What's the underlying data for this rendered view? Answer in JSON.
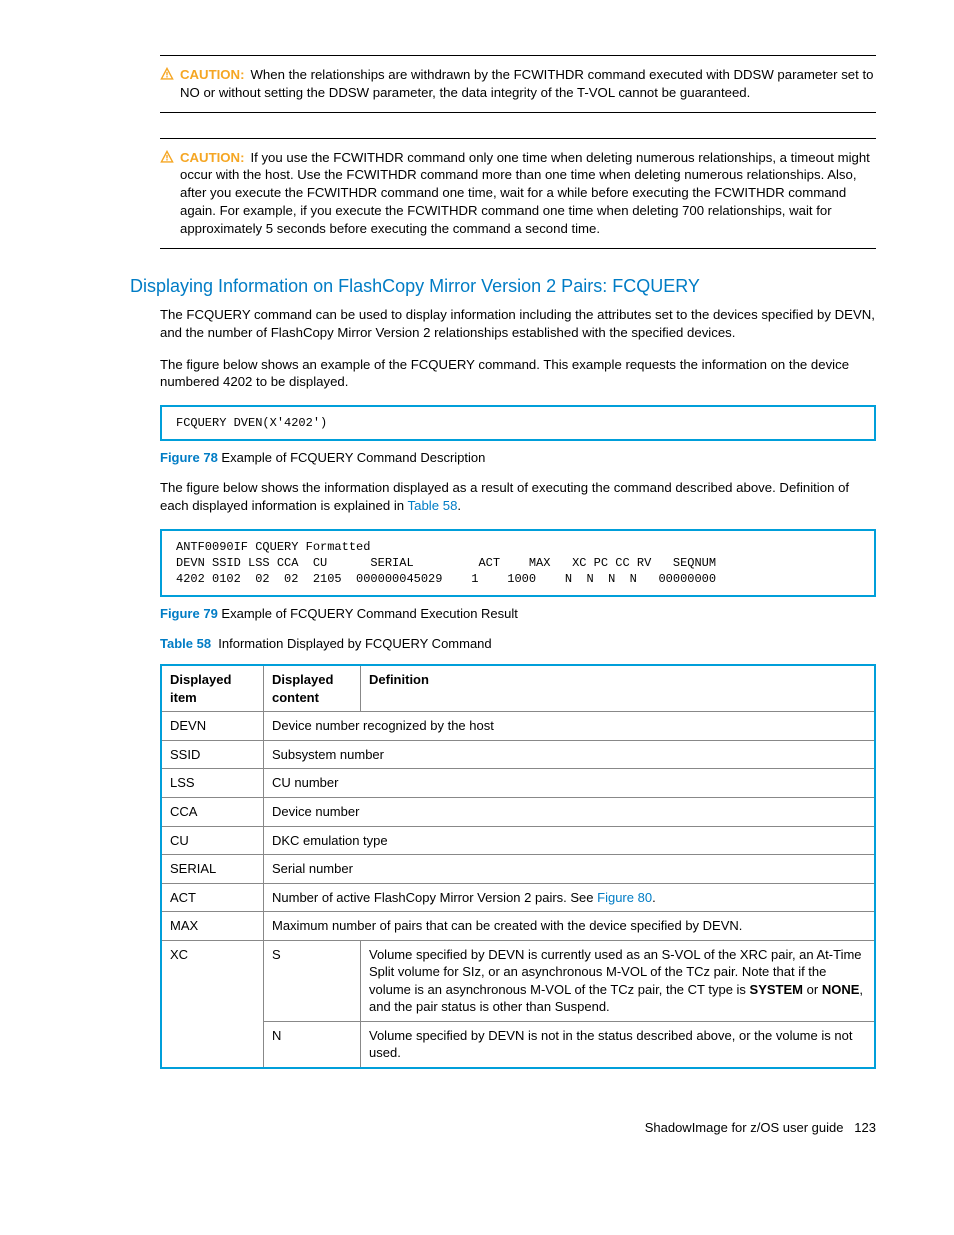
{
  "caution1": {
    "label": "CAUTION:",
    "text": "When the relationships are withdrawn by the FCWITHDR command executed with DDSW parameter set to NO or without setting the DDSW parameter, the data integrity of the T-VOL cannot be guaranteed."
  },
  "caution2": {
    "label": "CAUTION:",
    "text": "If you use the FCWITHDR command only one time when deleting numerous relationships, a timeout might occur with the host. Use the FCWITHDR command more than one time when deleting numerous relationships. Also, after you execute the FCWITHDR command one time, wait for a while before executing the FCWITHDR command again. For example, if you execute the FCWITHDR command one time when deleting 700 relationships, wait for approximately 5 seconds before executing the command a second time."
  },
  "section_title": "Displaying Information on FlashCopy Mirror Version 2 Pairs: FCQUERY",
  "para1": "The FCQUERY command can be used to display information including the attributes set to the devices specified by DEVN, and the number of FlashCopy Mirror Version 2 relationships established with the specified devices.",
  "para2": "The figure below shows an example of the FCQUERY command. This example requests the information on the device numbered 4202 to be displayed.",
  "code1": "FCQUERY DVEN(X'4202')",
  "fig78": {
    "label": "Figure 78",
    "text": "Example of FCQUERY Command Description"
  },
  "para3_a": "The figure below shows the information displayed as a result of executing the command described above. Definition of each displayed information is explained in ",
  "para3_link": "Table 58",
  "para3_b": ".",
  "code2": "ANTF0090IF CQUERY Formatted\nDEVN SSID LSS CCA  CU      SERIAL         ACT    MAX   XC PC CC RV   SEQNUM\n4202 0102  02  02  2105  000000045029    1    1000    N  N  N  N   00000000",
  "fig79": {
    "label": "Figure 79",
    "text": "Example of FCQUERY Command Execution Result"
  },
  "tab58": {
    "label": "Table 58",
    "text": "Information Displayed by FCQUERY Command"
  },
  "table": {
    "headers": {
      "c1": "Displayed item",
      "c2": "Displayed content",
      "c3": "Definition"
    },
    "rows": [
      {
        "item": "DEVN",
        "def": "Device number recognized by the host"
      },
      {
        "item": "SSID",
        "def": "Subsystem number"
      },
      {
        "item": "LSS",
        "def": "CU number"
      },
      {
        "item": "CCA",
        "def": "Device number"
      },
      {
        "item": "CU",
        "def": "DKC emulation type"
      },
      {
        "item": "SERIAL",
        "def": "Serial number"
      },
      {
        "item": "ACT",
        "def_a": "Number of active FlashCopy Mirror Version 2 pairs. See ",
        "def_link": "Figure 80",
        "def_b": "."
      },
      {
        "item": "MAX",
        "def": "Maximum number of pairs that can be created with the device specified by DEVN."
      }
    ],
    "xc": {
      "item": "XC",
      "s_content": "S",
      "s_def_a": "Volume specified by DEVN is currently used as an S-VOL of the XRC pair, an At-Time Split volume for SIz, or an asynchronous M-VOL of the TCz pair. Note that if the volume is an asynchronous M-VOL of the TCz pair, the CT type is ",
      "s_def_bold1": "SYSTEM",
      "s_def_mid": " or ",
      "s_def_bold2": "NONE",
      "s_def_b": ", and the pair status is other than Suspend.",
      "n_content": "N",
      "n_def": "Volume specified by DEVN is not in the status described above, or the volume is not used."
    }
  },
  "footer": {
    "title": "ShadowImage for z/OS user guide",
    "page": "123"
  }
}
